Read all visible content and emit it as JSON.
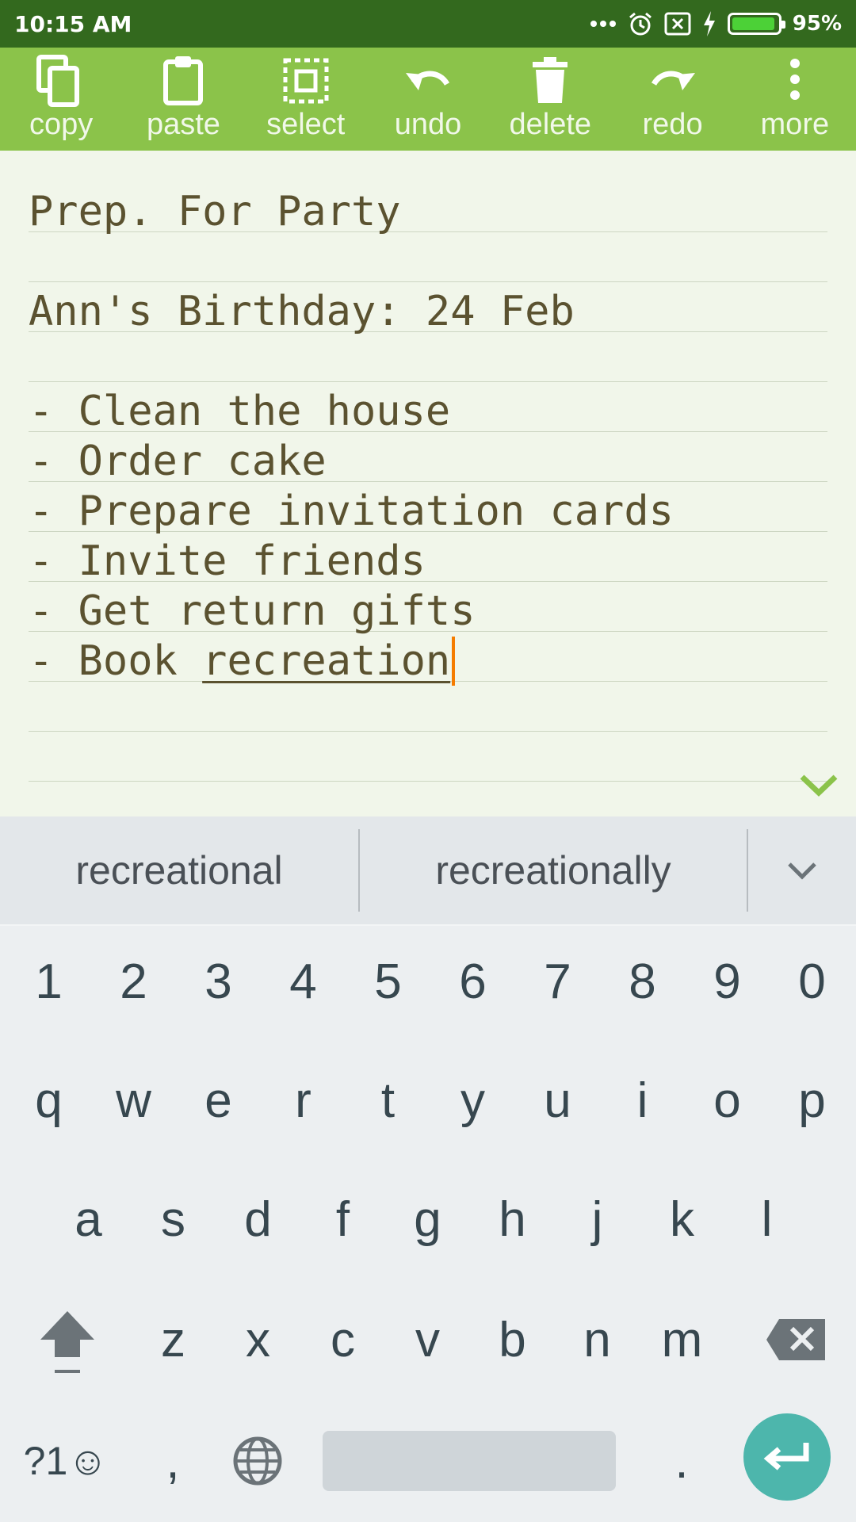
{
  "status_bar": {
    "time": "10:15 AM",
    "battery_percent": "95%",
    "battery_level": 0.95,
    "icons": [
      "more-dots-icon",
      "alarm-icon",
      "no-sim-icon",
      "charging-icon",
      "battery-icon"
    ]
  },
  "toolbar": {
    "items": [
      {
        "label": "copy",
        "icon": "copy-icon"
      },
      {
        "label": "paste",
        "icon": "paste-icon"
      },
      {
        "label": "select",
        "icon": "select-icon"
      },
      {
        "label": "undo",
        "icon": "undo-icon"
      },
      {
        "label": "delete",
        "icon": "delete-icon"
      },
      {
        "label": "redo",
        "icon": "redo-icon"
      },
      {
        "label": "more",
        "icon": "more-vertical-icon"
      }
    ]
  },
  "note": {
    "lines": [
      "Prep. For Party",
      "",
      "Ann's Birthday: 24 Feb",
      "",
      "- Clean the house",
      "- Order cake",
      "- Prepare invitation cards",
      "- Invite friends",
      "- Get return gifts"
    ],
    "last_line_prefix": "- Book ",
    "last_line_word": "recreation"
  },
  "suggestions": {
    "first": "recreational",
    "second": "recreationally"
  },
  "keyboard": {
    "number_row": [
      "1",
      "2",
      "3",
      "4",
      "5",
      "6",
      "7",
      "8",
      "9",
      "0"
    ],
    "row1": [
      "q",
      "w",
      "e",
      "r",
      "t",
      "y",
      "u",
      "i",
      "o",
      "p"
    ],
    "row2": [
      "a",
      "s",
      "d",
      "f",
      "g",
      "h",
      "j",
      "k",
      "l"
    ],
    "row3": [
      "z",
      "x",
      "c",
      "v",
      "b",
      "n",
      "m"
    ],
    "symbols_key": "?1☺",
    "comma_key": ",",
    "period_key": "."
  },
  "colors": {
    "status_bar": "#33691e",
    "toolbar": "#8bc34a",
    "editor_bg": "#f1f6ea",
    "text": "#5b5230",
    "cursor": "#f57c00",
    "enter": "#4db6ac"
  }
}
